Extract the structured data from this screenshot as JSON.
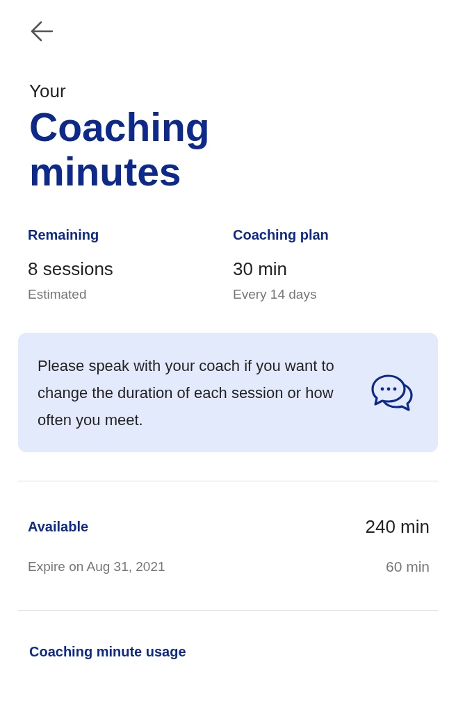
{
  "header": {
    "eyebrow": "Your",
    "title": "Coaching minutes"
  },
  "summary": [
    {
      "label": "Remaining",
      "value": "8 sessions",
      "note": "Estimated"
    },
    {
      "label": "Coaching plan",
      "value": "30 min",
      "note": "Every 14 days"
    }
  ],
  "info_card": {
    "text": "Please speak with your coach if you want to change the duration of each session or how often you meet."
  },
  "available": {
    "label": "Available",
    "total": "240 min",
    "expiry": "Expire on Aug 31, 2021",
    "expiring": "60 min"
  },
  "usage": {
    "title": "Coaching minute usage"
  }
}
